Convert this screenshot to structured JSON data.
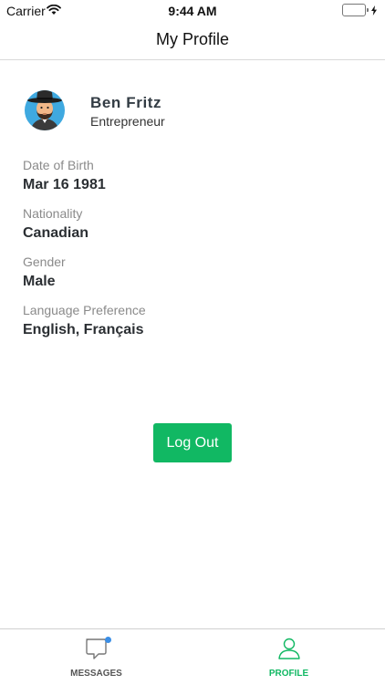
{
  "status_bar": {
    "carrier": "Carrier",
    "time": "9:44 AM",
    "battery_level": 1.0,
    "battery_color": "#4cd964"
  },
  "nav": {
    "title": "My Profile"
  },
  "profile": {
    "name": "Ben Fritz",
    "role": "Entrepreneur",
    "avatar_icon": "user-avatar-hat-beard"
  },
  "fields": [
    {
      "label": "Date of Birth",
      "value": "Mar 16 1981"
    },
    {
      "label": "Nationality",
      "value": "Canadian"
    },
    {
      "label": "Gender",
      "value": "Male"
    },
    {
      "label": "Language Preference",
      "value": "English, Français"
    }
  ],
  "actions": {
    "logout_label": "Log Out",
    "logout_color": "#11b863"
  },
  "tabs": [
    {
      "label": "MESSAGES",
      "icon": "chat-bubble-icon",
      "active": false,
      "has_badge": true
    },
    {
      "label": "PROFILE",
      "icon": "person-icon",
      "active": true,
      "has_badge": false
    }
  ],
  "colors": {
    "accent": "#11b863",
    "badge": "#3a8ee6"
  }
}
